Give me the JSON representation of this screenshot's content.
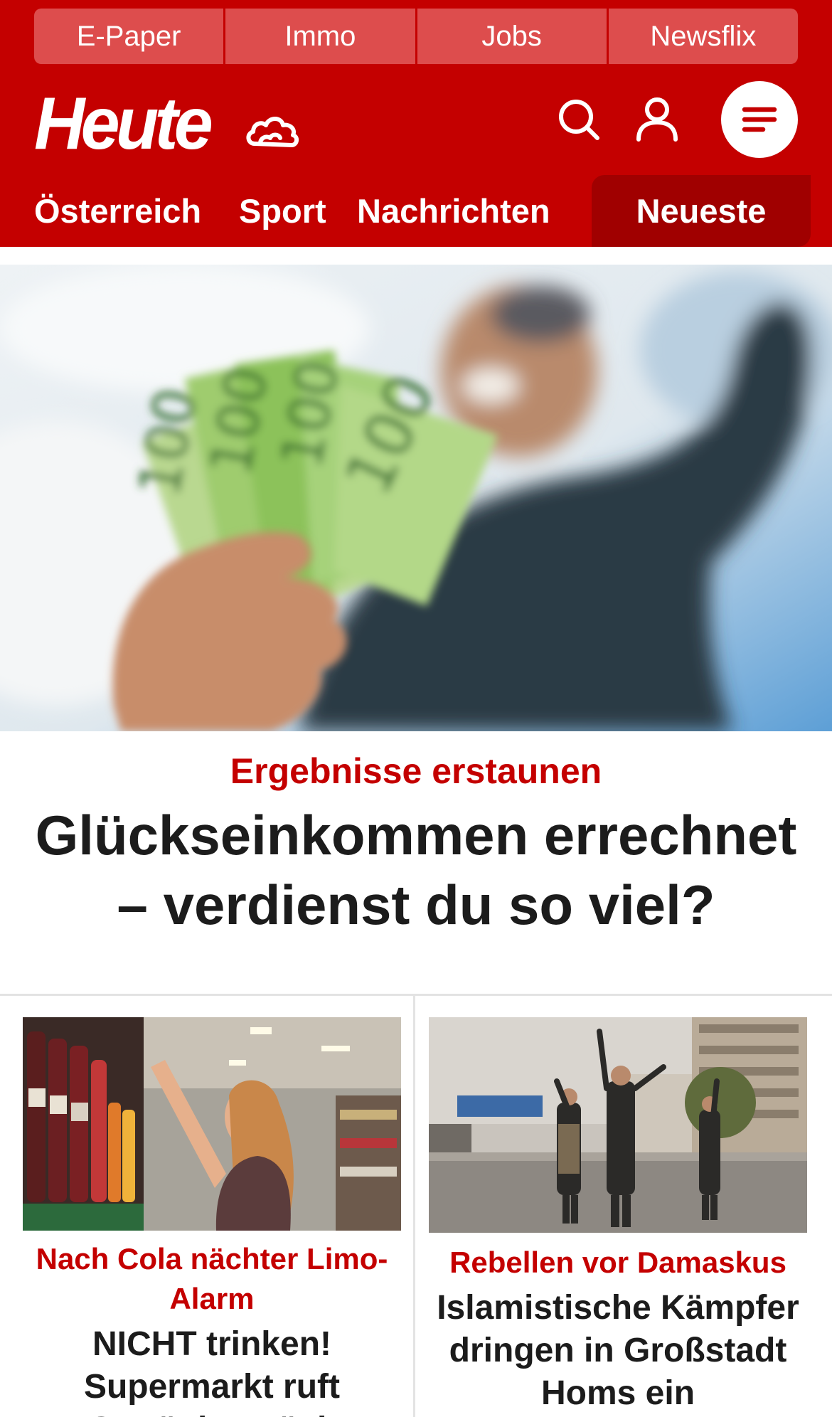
{
  "colors": {
    "brand_red": "#c40000",
    "nav_active_bg": "#a00000",
    "quicklink_bg": "#dd4d4d",
    "text_dark": "#1c1c1c",
    "divider": "#e3e3e3"
  },
  "quicklinks": [
    {
      "label": "E-Paper"
    },
    {
      "label": "Immo"
    },
    {
      "label": "Jobs"
    },
    {
      "label": "Newsflix"
    }
  ],
  "header": {
    "logo_text": "Heute",
    "icons": [
      "weather-cloud-icon",
      "search-icon",
      "user-icon",
      "menu-icon"
    ]
  },
  "nav": {
    "tabs": [
      {
        "label": "Österreich"
      },
      {
        "label": "Sport"
      },
      {
        "label": "Nachrichten"
      },
      {
        "label": "Neueste",
        "active": true
      }
    ]
  },
  "hero": {
    "kicker": "Ergebnisse erstaunen",
    "title": "Glückseinkommen errechnet – verdienst du so viel?"
  },
  "cards": [
    {
      "kicker": "Nach Cola nächter Limo-Alarm",
      "title": "NICHT trinken! Supermarkt ruft Getränk zurück"
    },
    {
      "kicker": "Rebellen vor Damaskus",
      "title": "Islamistische Kämpfer dringen in Großstadt Homs ein"
    }
  ]
}
